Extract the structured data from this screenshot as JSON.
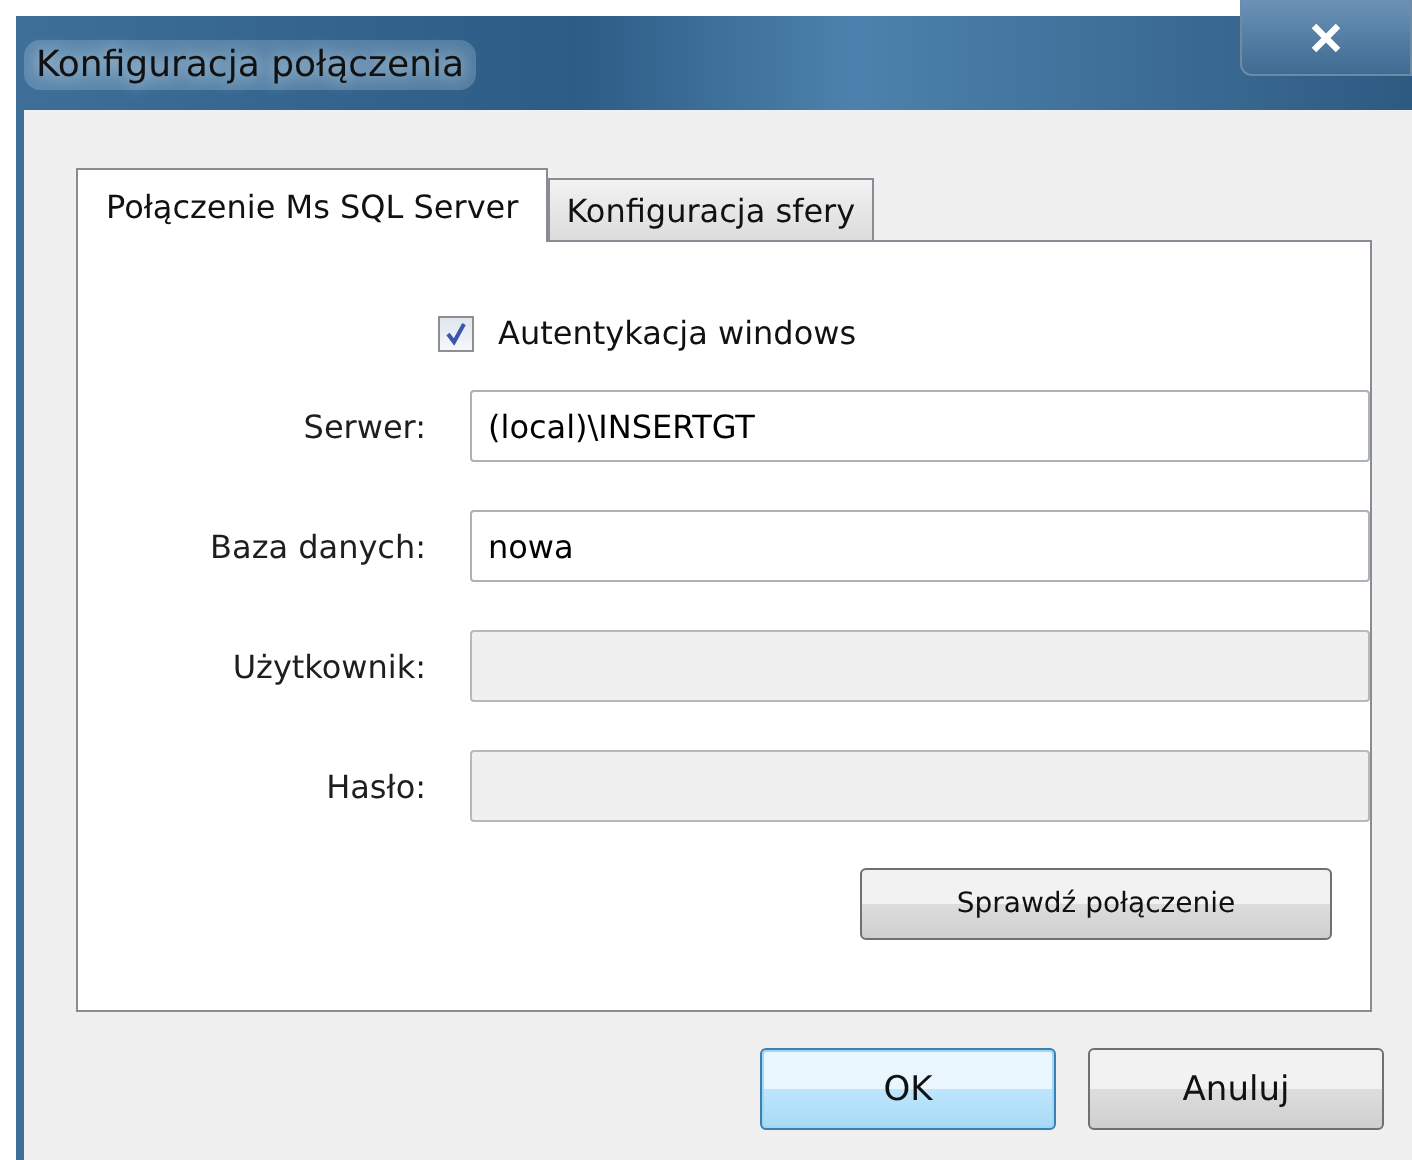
{
  "window": {
    "title": "Konfiguracja połączenia"
  },
  "tabs": [
    {
      "label": "Połączenie Ms SQL Server",
      "selected": true
    },
    {
      "label": "Konfiguracja sfery",
      "selected": false
    }
  ],
  "checkbox": {
    "label": "Autentykacja windows",
    "checked": true
  },
  "fields": [
    {
      "label": "Serwer:",
      "value": "(local)\\INSERTGT",
      "disabled": false
    },
    {
      "label": "Baza danych:",
      "value": "nowa",
      "disabled": false
    },
    {
      "label": "Użytkownik:",
      "disabled": true
    },
    {
      "label": "Hasło:",
      "disabled": true
    }
  ],
  "test_button": {
    "label": "Sprawdź połączenie"
  },
  "buttons": [
    {
      "label": "OK",
      "default": true
    },
    {
      "label": "Anuluj",
      "default": false
    }
  ]
}
